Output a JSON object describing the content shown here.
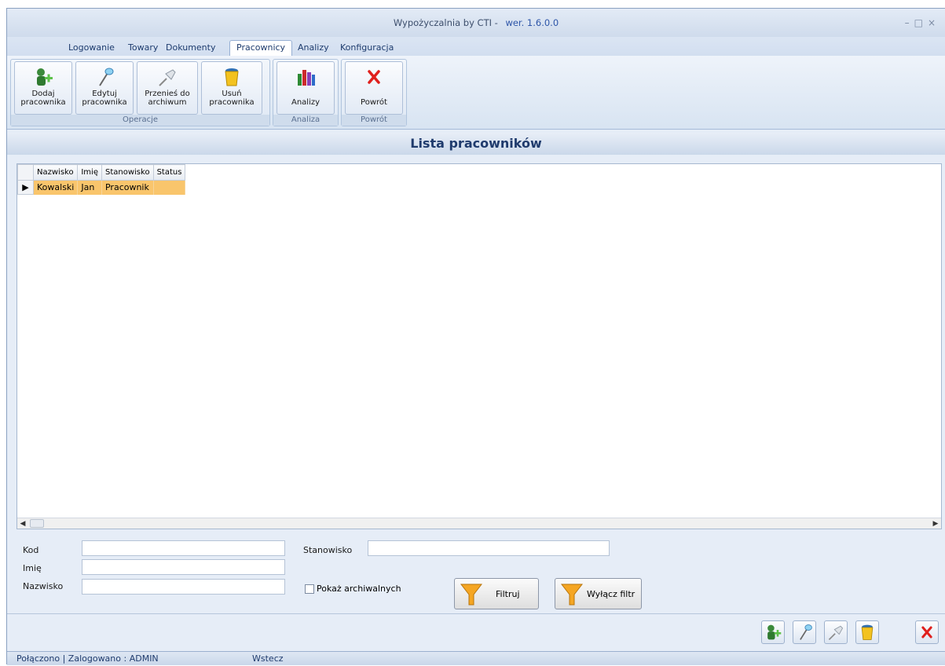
{
  "window": {
    "title": "Wypożyczalnia by CTI -",
    "version": "wer. 1.6.0.0"
  },
  "tabs": [
    {
      "label": "Logowanie"
    },
    {
      "label": "Towary"
    },
    {
      "label": "Dokumenty"
    },
    {
      "label": "Pracownicy",
      "active": true
    },
    {
      "label": "Analizy"
    },
    {
      "label": "Konfiguracja"
    }
  ],
  "ribbon": {
    "groups": {
      "operacje": "Operacje",
      "analiza": "Analiza",
      "powrot": "Powrót"
    },
    "buttons": {
      "dodaj_1": "Dodaj",
      "dodaj_2": "pracownika",
      "edytuj_1": "Edytuj",
      "edytuj_2": "pracownika",
      "przenies_1": "Przenieś do",
      "przenies_2": "archiwum",
      "usun_1": "Usuń",
      "usun_2": "pracownika",
      "analizy": "Analizy",
      "powrot": "Powrót"
    },
    "icons": [
      "add-user-icon",
      "edit-icon",
      "pin-icon",
      "trash-icon",
      "books-icon",
      "close-icon"
    ]
  },
  "header": {
    "title": "Lista pracowników"
  },
  "grid": {
    "columns": [
      "Nazwisko",
      "Imię",
      "Stanowisko",
      "Status"
    ],
    "rows": [
      {
        "nazwisko": "Kowalski",
        "imie": "Jan",
        "stanowisko": "Pracownik",
        "status": ""
      }
    ],
    "selected_color": "#f9c56c"
  },
  "filter": {
    "kod_label": "Kod",
    "kod_value": "",
    "imie_label": "Imię",
    "imie_value": "",
    "nazwisko_label": "Nazwisko",
    "nazwisko_value": "",
    "stanowisko_label": "Stanowisko",
    "stanowisko_value": "",
    "archive_label": "Pokaż archiwalnych",
    "archive_checked": false,
    "filter_button": "Filtruj",
    "clear_filter_button": "Wyłącz filtr"
  },
  "status_bar": {
    "connection": "Połączono | Zalogowano : ADMIN",
    "back": "Wstecz"
  }
}
